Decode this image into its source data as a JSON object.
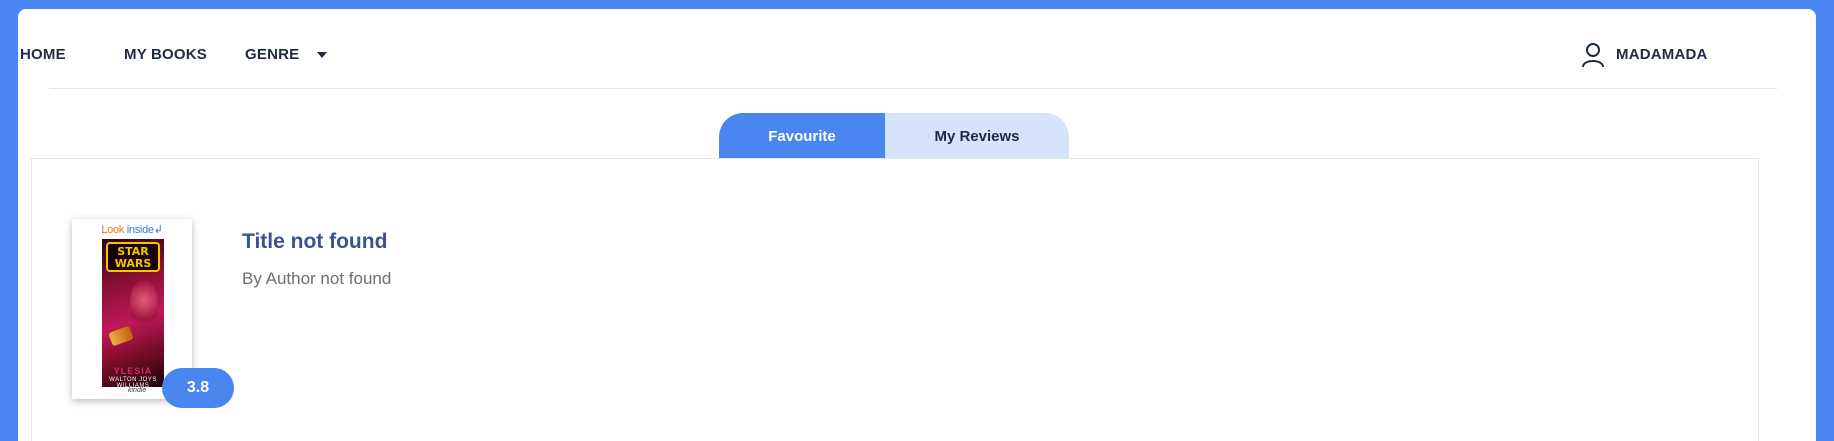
{
  "nav": {
    "home": "HOME",
    "my_books": "MY BOOKS",
    "genre": "GENRE",
    "user_name": "MADAMADA"
  },
  "tabs": [
    {
      "label": "Favourite",
      "active": true
    },
    {
      "label": "My Reviews",
      "active": false
    }
  ],
  "book": {
    "title": "Title not found",
    "author": "By Author not found",
    "rating": "3.8",
    "cover": {
      "look_label": "Look",
      "inside_label": "inside",
      "logo_line1": "STAR",
      "logo_line2": "WARS",
      "cover_title": "YLESIA",
      "cover_author": "WALTON JOYS WILLIAMS",
      "kindle": "kindle"
    }
  },
  "colors": {
    "accent": "#4a86ef",
    "tab_inactive": "#d6e4fb",
    "title": "#3c5193",
    "text_dark": "#1f2a44",
    "text_muted": "#6b6f76"
  },
  "icons": {
    "genre_caret": "caret-down-icon",
    "user": "user-icon"
  }
}
